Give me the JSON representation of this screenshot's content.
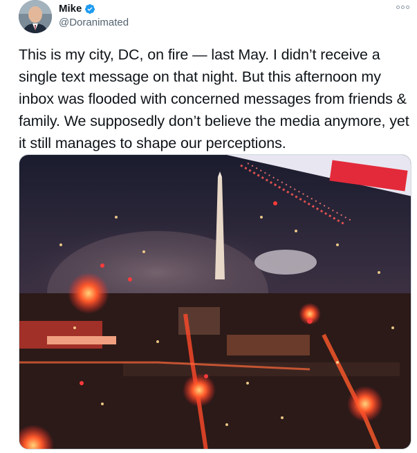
{
  "author": {
    "name": "Mike",
    "handle": "@Doranimated",
    "avatar": "avatar-photo",
    "verified": true
  },
  "tweet": {
    "text": "This is my city, DC, on fire — last May. I didn’t receive a single text message on that night. But this afternoon my inbox was flooded with concerned messages from friends & family. We supposedly don’t believe the media anymore, yet it still manages to shape our perceptions."
  },
  "icons": {
    "verified": "verified-badge-icon",
    "more": "more-options-icon"
  },
  "colors": {
    "verified_blue": "#1d9bf0",
    "text_primary": "#0f1419",
    "text_secondary": "#536471"
  }
}
